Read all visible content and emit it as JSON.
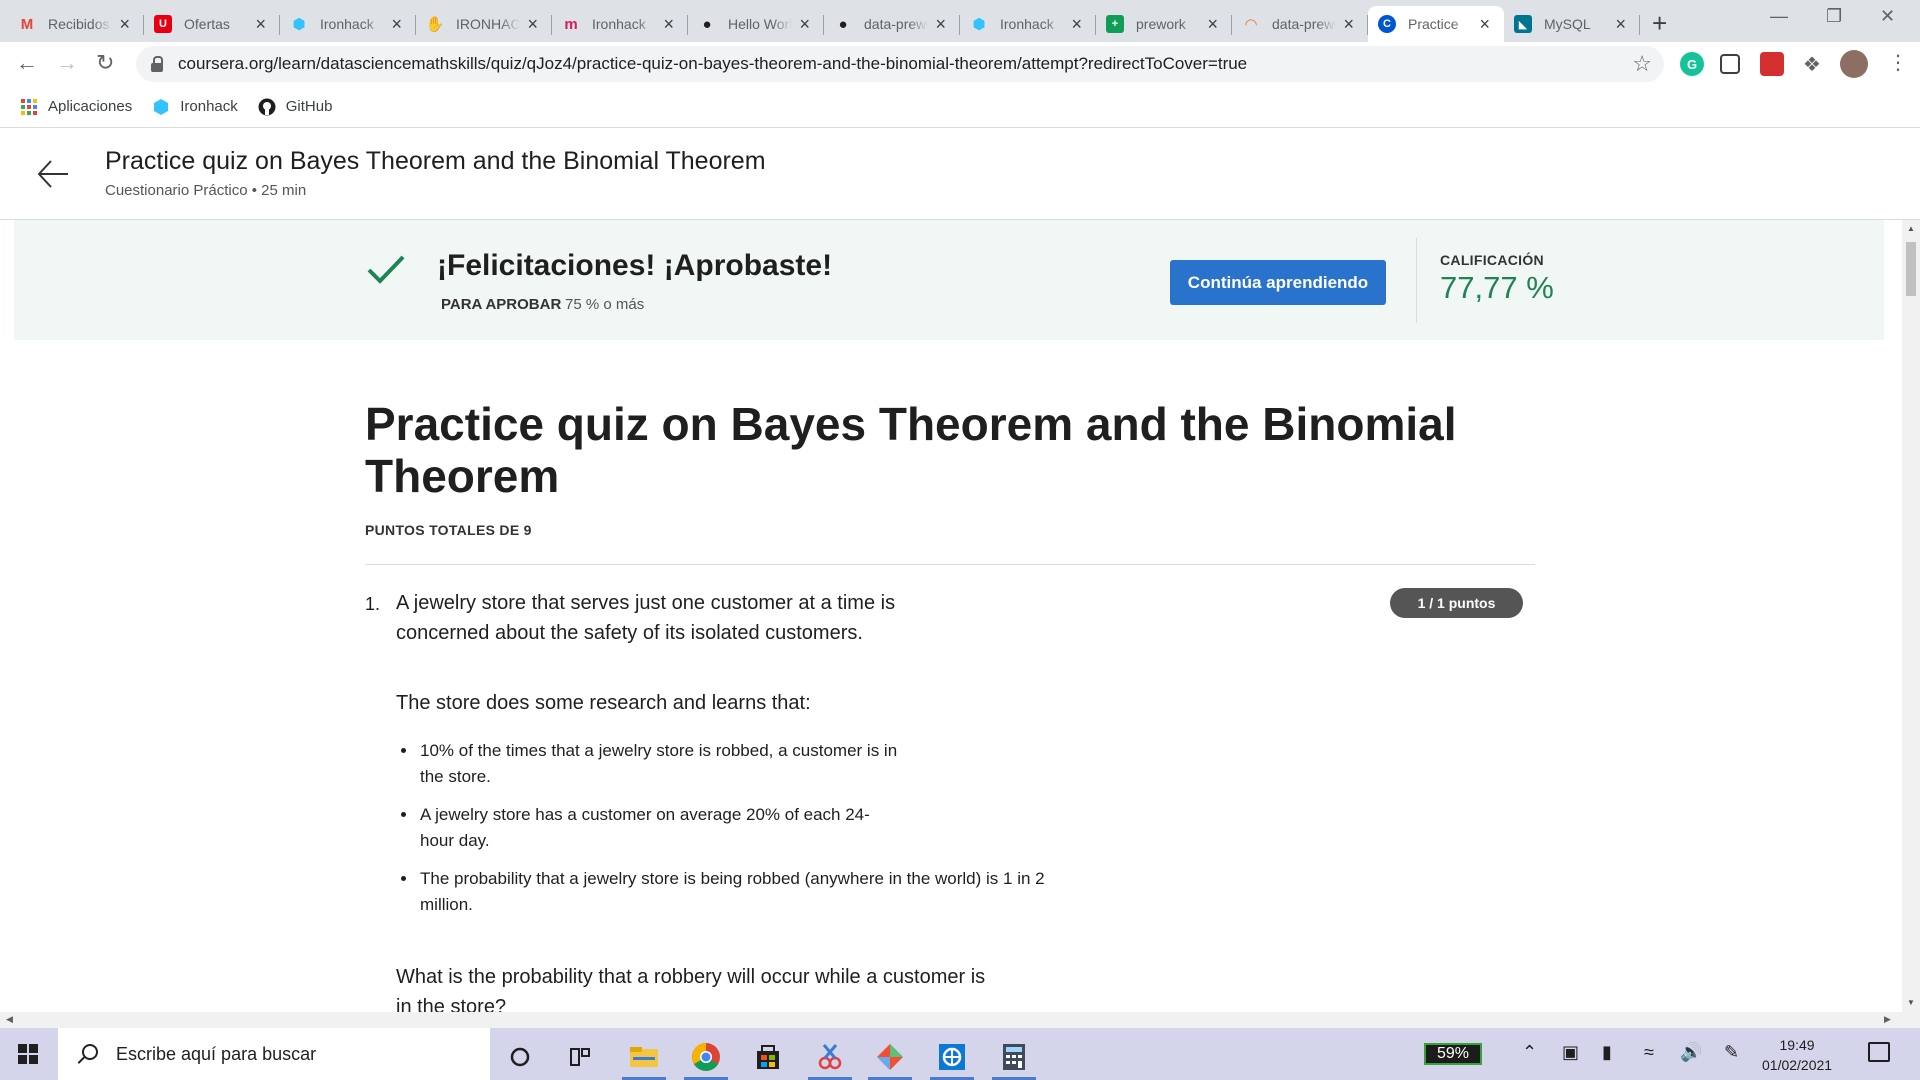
{
  "browser": {
    "tabs": [
      {
        "title": "Recibidos",
        "icon": "gmail-icon",
        "color": "#ea4335"
      },
      {
        "title": "Ofertas",
        "icon": "uniqlo-icon",
        "color": "#e60012"
      },
      {
        "title": "Ironhack",
        "icon": "ironhack-icon",
        "color": "#32c3ff"
      },
      {
        "title": "IRONHACK",
        "icon": "yellow-hand-icon",
        "color": "#f4c20d"
      },
      {
        "title": "Ironhack",
        "icon": "m-logo-icon",
        "color": "#d81b60"
      },
      {
        "title": "Hello World",
        "icon": "github-icon",
        "color": "#1f1f1f"
      },
      {
        "title": "data-prework",
        "icon": "github-icon",
        "color": "#1f1f1f"
      },
      {
        "title": "Ironhack",
        "icon": "ironhack-icon",
        "color": "#32c3ff"
      },
      {
        "title": "prework",
        "icon": "sheets-plus-icon",
        "color": "#0f9d58"
      },
      {
        "title": "data-prework",
        "icon": "jupyter-icon",
        "color": "#f37626"
      },
      {
        "title": "Practice",
        "icon": "coursera-icon",
        "color": "#0056d2"
      },
      {
        "title": "MySQL",
        "icon": "mysql-icon",
        "color": "#00758f"
      }
    ],
    "active_tab": 10,
    "url": "coursera.org/learn/datasciencemathskills/quiz/qJoz4/practice-quiz-on-bayes-theorem-and-the-binomial-theorem/attempt?redirectToCover=true",
    "bookmarks": [
      {
        "label": "Aplicaciones"
      },
      {
        "label": "Ironhack"
      },
      {
        "label": "GitHub"
      }
    ]
  },
  "header": {
    "title": "Practice quiz on Bayes Theorem and the Binomial Theorem",
    "subtitle": "Cuestionario Práctico • 25 min"
  },
  "result": {
    "message": "¡Felicitaciones! ¡Aprobaste!",
    "pass_label": "PARA APROBAR",
    "pass_value": "75 % o más",
    "continue_label": "Continúa aprendiendo",
    "grade_label": "CALIFICACIÓN",
    "grade_value": "77,77 %",
    "accent": "#1f8354",
    "button_color": "#2a73cc"
  },
  "quiz": {
    "title": "Practice quiz on Bayes Theorem and the Binomial Theorem",
    "total_points": "PUNTOS TOTALES DE 9",
    "questions": [
      {
        "number": "1.",
        "text": "A jewelry store that serves just one customer at a time is concerned about the safety of its isolated customers.",
        "points": "1 / 1 puntos",
        "intro": "The store does some research and learns that:",
        "bullets": [
          "10% of the times that a jewelry store is robbed, a customer is in the store.",
          "A jewelry store has a customer on average 20% of each 24-hour day.",
          "The probability that a jewelry store is being robbed (anywhere in the world) is 1 in 2 million."
        ],
        "question": "What is the probability that a robbery will occur while a customer is in the store?"
      }
    ]
  },
  "taskbar": {
    "search_placeholder": "Escribe aquí para buscar",
    "battery": "59%",
    "time": "19:49",
    "date": "01/02/2021"
  }
}
